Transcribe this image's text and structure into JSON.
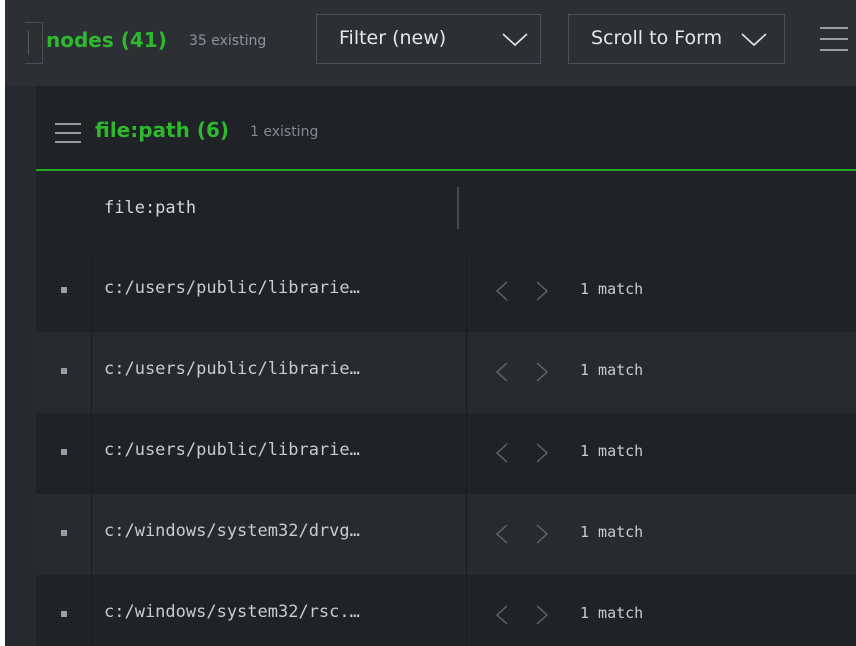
{
  "toolbar": {
    "nodes_title": "nodes (41)",
    "nodes_subtitle": "35 existing",
    "filter_label": "Filter (new)",
    "scroll_label": "Scroll to Form"
  },
  "panel": {
    "title": "file:path (6)",
    "subtitle": "1 existing",
    "column_header": "file:path",
    "rows": [
      {
        "path": "c:/users/public/librarie…",
        "match": "1 match"
      },
      {
        "path": "c:/users/public/librarie…",
        "match": "1 match"
      },
      {
        "path": "c:/users/public/librarie…",
        "match": "1 match"
      },
      {
        "path": "c:/windows/system32/drvg…",
        "match": "1 match"
      },
      {
        "path": "c:/windows/system32/rsc.…",
        "match": "1 match"
      }
    ]
  },
  "icons": {
    "menu": "hamburger-icon",
    "dropdown": "chevron-down-icon",
    "prev": "chevron-left-icon",
    "next": "chevron-right-icon",
    "bullet": "square-bullet-icon"
  },
  "colors": {
    "accent_green": "#2eb82e",
    "background": "#262a2f",
    "panel": "#1f2226",
    "row_alt": "#272b30"
  }
}
